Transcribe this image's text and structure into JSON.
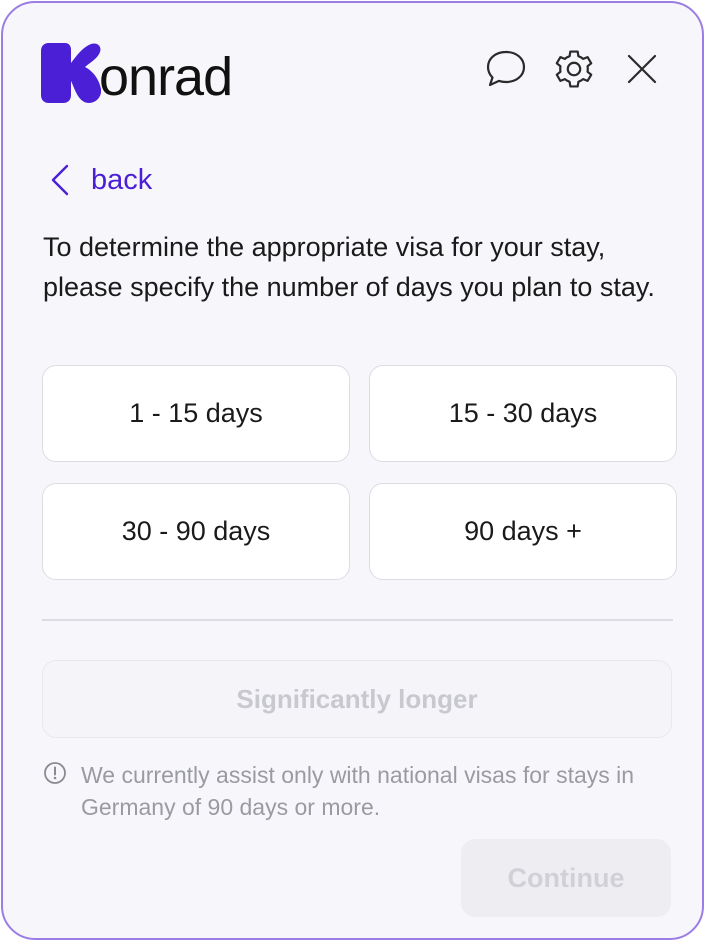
{
  "brand": {
    "name_suffix": "onrad",
    "logo_icon": "konrad-k-logo",
    "accent_color": "#4a1fd6",
    "border_color": "#9b7de3"
  },
  "header": {
    "icons": [
      "chat-bubble-icon",
      "gear-icon",
      "close-icon"
    ]
  },
  "nav": {
    "back_label": "back"
  },
  "question": {
    "text": "To determine the appropriate visa for your stay, please specify the number of days you plan to stay."
  },
  "options": [
    {
      "label": "1 - 15 days"
    },
    {
      "label": "15 - 30 days"
    },
    {
      "label": "30 - 90 days"
    },
    {
      "label": "90 days +"
    }
  ],
  "longer_option": {
    "label": "Significantly longer",
    "state": "disabled"
  },
  "notice": {
    "icon": "info-circle-icon",
    "text": "We currently assist only with national visas for stays in Germany of 90 days or more."
  },
  "footer": {
    "continue_label": "Continue",
    "continue_state": "disabled"
  }
}
